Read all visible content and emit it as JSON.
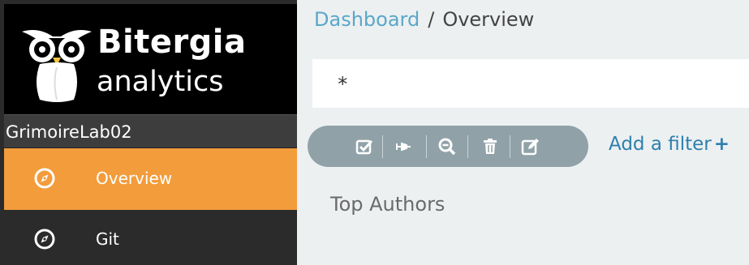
{
  "brand": {
    "name": "Bitergia",
    "subtitle": "analytics"
  },
  "instance": {
    "name": "GrimoireLab02"
  },
  "sidebar": {
    "items": [
      {
        "label": "Overview",
        "icon": "compass-icon",
        "active": true
      },
      {
        "label": "Git",
        "icon": "compass-icon",
        "active": false
      }
    ]
  },
  "breadcrumb": {
    "parent": "Dashboard",
    "separator": "/",
    "current": "Overview"
  },
  "query": {
    "value": "*"
  },
  "filter_bar": {
    "buttons": [
      "check-square-icon",
      "pin-icon",
      "zoom-out-icon",
      "trash-icon",
      "edit-icon"
    ],
    "add_filter_label": "Add a filter",
    "add_filter_icon": "+"
  },
  "panel": {
    "title": "Top Authors"
  },
  "colors": {
    "active_nav": "#f29c3c",
    "sidebar_bg": "#2b2b2b",
    "link": "#5ba7c9",
    "add_filter": "#2e7fae",
    "pill": "#8c9ea4",
    "page_bg": "#ecf0f1"
  }
}
